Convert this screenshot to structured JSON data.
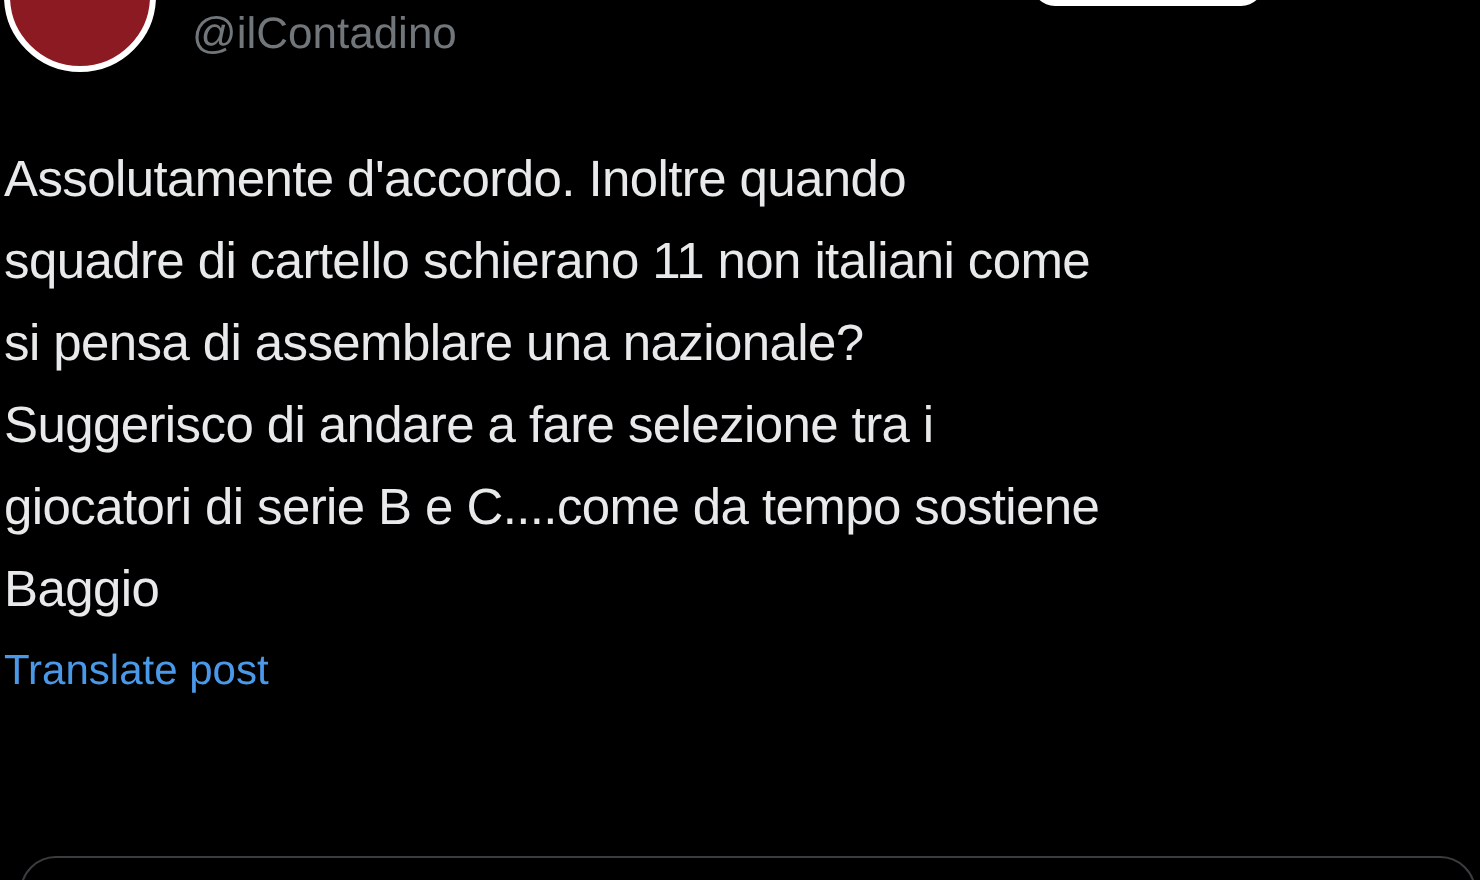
{
  "author": {
    "handle": "@ilContadino"
  },
  "post": {
    "lines": [
      "Assolutamente d'accordo. Inoltre quando",
      "squadre di cartello schierano 11 non italiani come",
      "si pensa di assemblare una nazionale?",
      "Suggerisco di andare a fare selezione tra i",
      "giocatori di serie B e C....come da tempo sostiene",
      "Baggio"
    ]
  },
  "translate_link": "Translate post"
}
